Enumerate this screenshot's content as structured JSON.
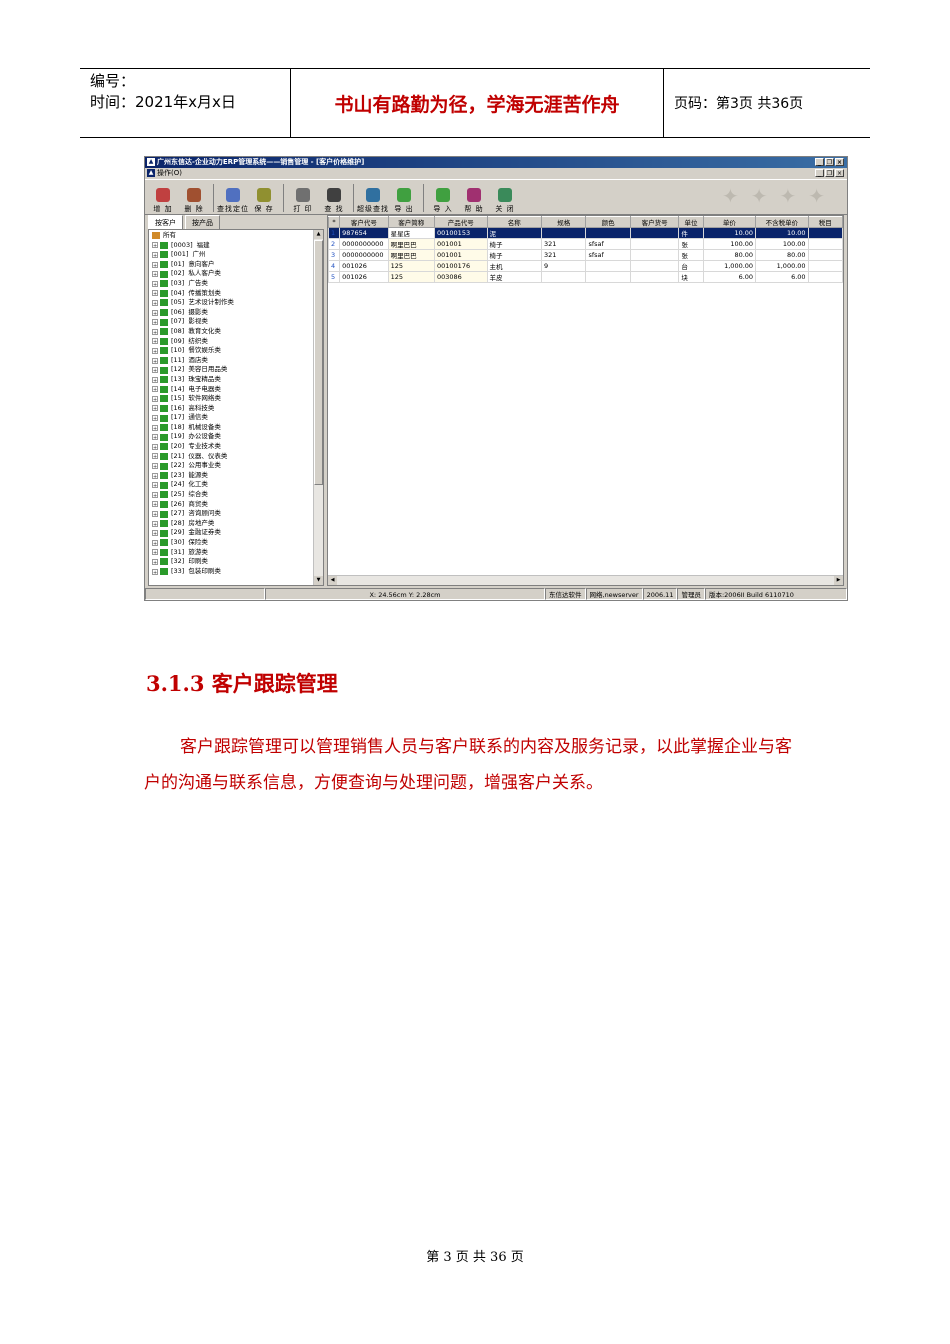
{
  "header": {
    "number_label": "编号：",
    "time_label": "时间：2021年x月x日",
    "motto": "书山有路勤为径，学海无涯苦作舟",
    "page_label": "页码：第3页  共36页"
  },
  "window": {
    "title": "广州东信达-企业动力ERP管理系统——销售管理 - [客户价格维护]",
    "menu": "操作(O)",
    "toolbar": [
      {
        "label": "增 加",
        "icon": "add-icon",
        "color": "#c04040"
      },
      {
        "label": "删 除",
        "icon": "delete-icon",
        "color": "#a05030"
      },
      {
        "label": "查找定位",
        "icon": "locate-icon",
        "color": "#5070c0"
      },
      {
        "label": "保 存",
        "icon": "save-icon",
        "color": "#909030"
      },
      {
        "label": "打 印",
        "icon": "print-icon",
        "color": "#707070"
      },
      {
        "label": "查 找",
        "icon": "search-icon",
        "color": "#404040"
      },
      {
        "label": "超级查找",
        "icon": "super-search-icon",
        "color": "#3070a0"
      },
      {
        "label": "导 出",
        "icon": "export-icon",
        "color": "#40a040"
      },
      {
        "label": "导 入",
        "icon": "import-icon",
        "color": "#40a040"
      },
      {
        "label": "帮 助",
        "icon": "help-icon",
        "color": "#a03070"
      },
      {
        "label": "关 闭",
        "icon": "exit-icon",
        "color": "#3a8a5a"
      }
    ],
    "tabs": [
      "按客户",
      "按产品"
    ],
    "tree_root": "所有",
    "tree_items": [
      {
        "code": "[0003]",
        "name": "福建"
      },
      {
        "code": "[001]",
        "name": "广州"
      },
      {
        "code": "[01]",
        "name": "意向客户"
      },
      {
        "code": "[02]",
        "name": "私人客户类"
      },
      {
        "code": "[03]",
        "name": "广告类"
      },
      {
        "code": "[04]",
        "name": "传播策划类"
      },
      {
        "code": "[05]",
        "name": "艺术设计制作类"
      },
      {
        "code": "[06]",
        "name": "摄影类"
      },
      {
        "code": "[07]",
        "name": "影视类"
      },
      {
        "code": "[08]",
        "name": "教育文化类"
      },
      {
        "code": "[09]",
        "name": "纺织类"
      },
      {
        "code": "[10]",
        "name": "餐饮娱乐类"
      },
      {
        "code": "[11]",
        "name": "酒店类"
      },
      {
        "code": "[12]",
        "name": "美容日用品类"
      },
      {
        "code": "[13]",
        "name": "珠宝精品类"
      },
      {
        "code": "[14]",
        "name": "电子电器类"
      },
      {
        "code": "[15]",
        "name": "软件网络类"
      },
      {
        "code": "[16]",
        "name": "高科技类"
      },
      {
        "code": "[17]",
        "name": "通信类"
      },
      {
        "code": "[18]",
        "name": "机械设备类"
      },
      {
        "code": "[19]",
        "name": "办公设备类"
      },
      {
        "code": "[20]",
        "name": "专业技术类"
      },
      {
        "code": "[21]",
        "name": "仪器、仪表类"
      },
      {
        "code": "[22]",
        "name": "公用事业类"
      },
      {
        "code": "[23]",
        "name": "能源类"
      },
      {
        "code": "[24]",
        "name": "化工类"
      },
      {
        "code": "[25]",
        "name": "综合类"
      },
      {
        "code": "[26]",
        "name": "商贸类"
      },
      {
        "code": "[27]",
        "name": "咨询顾问类"
      },
      {
        "code": "[28]",
        "name": "房地产类"
      },
      {
        "code": "[29]",
        "name": "金融证券类"
      },
      {
        "code": "[30]",
        "name": "保险类"
      },
      {
        "code": "[31]",
        "name": "旅游类"
      },
      {
        "code": "[32]",
        "name": "印刷类"
      },
      {
        "code": "[33]",
        "name": "包装印刷类"
      }
    ],
    "grid_columns": [
      "*",
      "客户代号",
      "客户简称",
      "产品代号",
      "名称",
      "规格",
      "颜色",
      "客户货号",
      "单位",
      "单价",
      "不含税单价",
      "税目"
    ],
    "grid_rows": [
      [
        "1",
        "987654",
        "星星店",
        "00100153",
        "泥",
        "",
        "",
        "",
        "件",
        "10.00",
        "10.00",
        ""
      ],
      [
        "2",
        "0000000000",
        "啊里巴巴",
        "001001",
        "椅子",
        "321",
        "sfsaf",
        "",
        "张",
        "100.00",
        "100.00",
        ""
      ],
      [
        "3",
        "0000000000",
        "啊里巴巴",
        "001001",
        "椅子",
        "321",
        "sfsaf",
        "",
        "张",
        "80.00",
        "80.00",
        ""
      ],
      [
        "4",
        "001026",
        "125",
        "00100176",
        "主机",
        "9",
        "",
        "",
        "台",
        "1,000.00",
        "1,000.00",
        ""
      ],
      [
        "5",
        "001026",
        "125",
        "003086",
        "羊皮",
        "",
        "",
        "",
        "块",
        "6.00",
        "6.00",
        ""
      ]
    ],
    "status": {
      "coords": "X: 24.56cm   Y: 2.28cm",
      "company": "东信达软件",
      "network": "网络,newserver",
      "date": "2006.11",
      "user": "管理员",
      "version": "版本:2006II Build 6110710"
    }
  },
  "section": {
    "heading": "3.1.3 客户跟踪管理",
    "paragraph": "客户跟踪管理可以管理销售人员与客户联系的内容及服务记录，以此掌握企业与客户的沟通与联系信息，方便查询与处理问题，增强客户关系。"
  },
  "footer": "第 3 页 共 36 页"
}
